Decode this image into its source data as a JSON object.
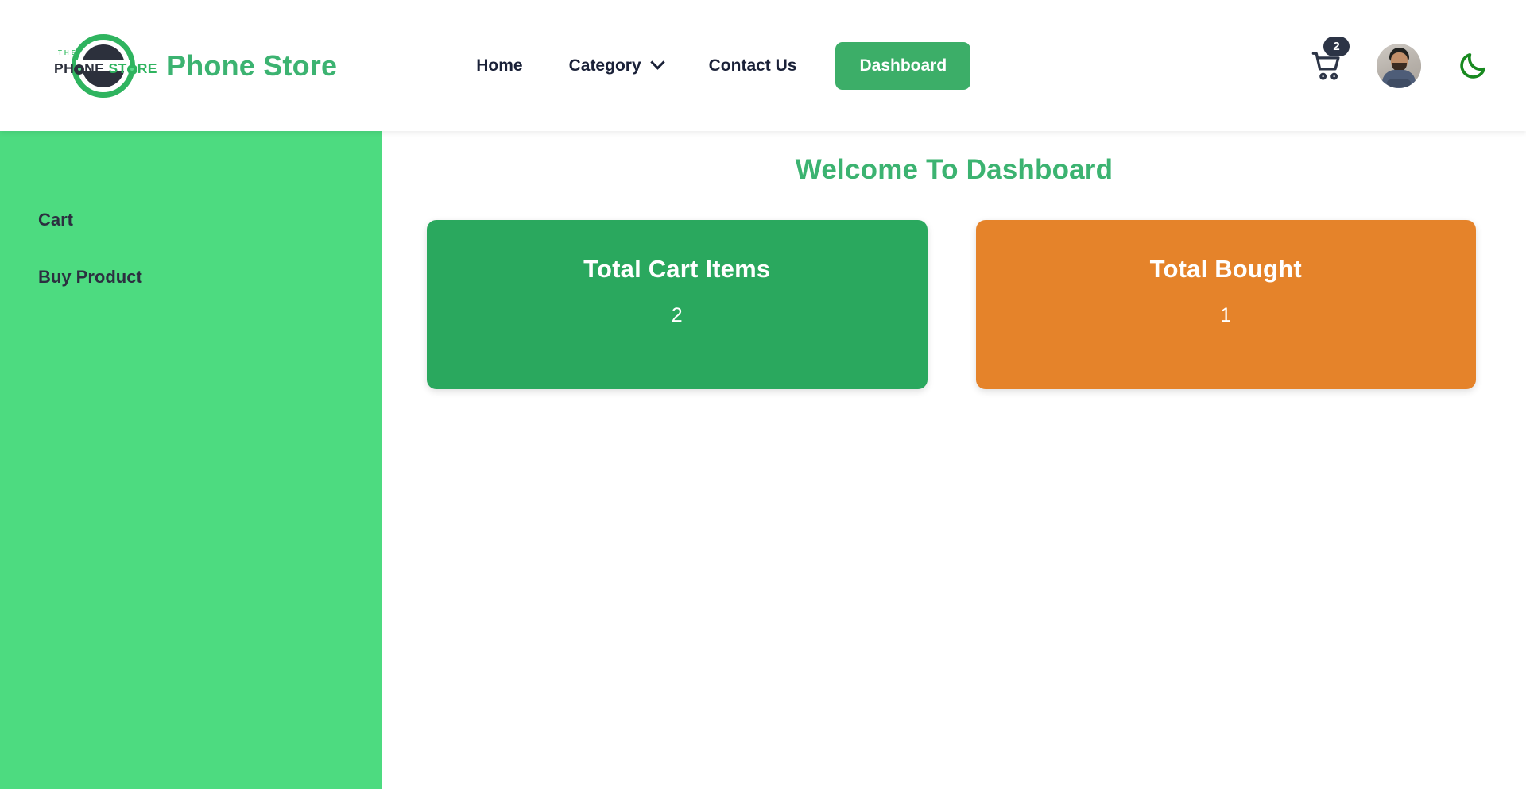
{
  "header": {
    "logo": {
      "name": "phone-store-logo",
      "top_text": "THE",
      "word_one": "PH",
      "word_one_tail": "NE",
      "word_two": "ST",
      "word_two_tail": "RE"
    },
    "brand_title": "Phone Store",
    "nav": [
      {
        "label": "Home",
        "name": "nav-home",
        "has_caret": false,
        "active": false
      },
      {
        "label": "Category",
        "name": "nav-category",
        "has_caret": true,
        "active": false
      },
      {
        "label": "Contact Us",
        "name": "nav-contact-us",
        "has_caret": false,
        "active": false
      }
    ],
    "dashboard_button": "Dashboard",
    "cart": {
      "icon": "shopping-cart-icon",
      "badge_count": "2"
    },
    "avatar_alt": "user-avatar",
    "theme_toggle_icon": "moon-icon"
  },
  "sidebar": {
    "items": [
      {
        "label": "Cart",
        "name": "sidebar-item-cart"
      },
      {
        "label": "Buy Product",
        "name": "sidebar-item-buy-product"
      }
    ]
  },
  "main": {
    "page_title": "Welcome To Dashboard",
    "cards": [
      {
        "title": "Total Cart Items",
        "value": "2",
        "color": "#2aa85e",
        "name": "stat-card-total-cart-items"
      },
      {
        "title": "Total Bought",
        "value": "1",
        "color": "#e5832a",
        "name": "stat-card-total-bought"
      }
    ]
  },
  "colors": {
    "brand_green": "#3cb371",
    "sidebar_green": "#4ddb80",
    "card_green": "#2aa85e",
    "card_orange": "#e5832a",
    "nav_text": "#1a2138",
    "badge_bg": "#2c3446"
  }
}
